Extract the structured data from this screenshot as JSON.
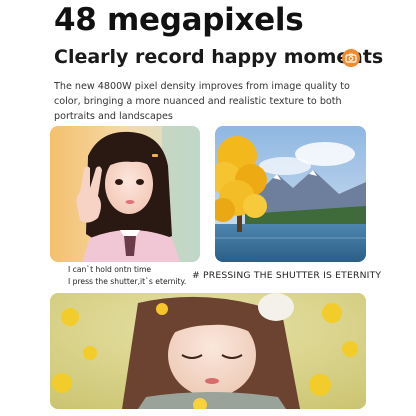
{
  "header": {
    "headline": "48 megapixels",
    "subheadline": "Clearly record happy moments",
    "badge_icon": "camera-icon",
    "accent_color": "#f08a2c"
  },
  "description": "The new 4800W pixel density improves from image quality to color, bringing a more nuanced and realistic texture to both portraits and landscapes",
  "captions": {
    "left_line1": "I can`t hold ontn time",
    "left_line2": "I press the shutter,it`s eternity.",
    "right": "# PRESSING THE SHUTTER IS ETERNITY"
  }
}
